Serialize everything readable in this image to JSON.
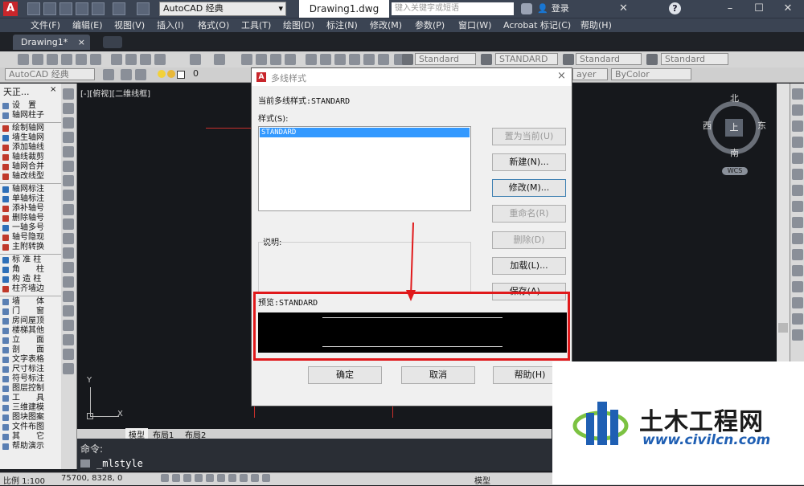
{
  "app": {
    "workspace": "AutoCAD 经典",
    "document_title": "Drawing1.dwg",
    "search_placeholder": "键入关键字或短语",
    "login": "登录"
  },
  "menu": [
    "文件(F)",
    "编辑(E)",
    "视图(V)",
    "插入(I)",
    "格式(O)",
    "工具(T)",
    "绘图(D)",
    "标注(N)",
    "修改(M)",
    "参数(P)",
    "窗口(W)",
    "Acrobat 标记(C)",
    "帮助(H)"
  ],
  "tabs": {
    "active": "Drawing1*"
  },
  "toolbar": {
    "text_style": "Standard",
    "dim_style": "STANDARD",
    "table_style": "Standard",
    "mleader_style": "Standard",
    "workspace2": "AutoCAD 经典",
    "layer_value": "0",
    "layer_right": "ayer",
    "color": "ByColor"
  },
  "palette": {
    "title": "天正...",
    "items": [
      "设　置",
      "轴网柱子",
      "绘制轴网",
      "墙生轴网",
      "添加轴线",
      "轴线裁剪",
      "轴网合并",
      "轴改线型",
      "轴网标注",
      "单轴标注",
      "添补轴号",
      "删除轴号",
      "一轴多号",
      "轴号隐现",
      "主附转换",
      "标 准 柱",
      "角　　柱",
      "构 造 柱",
      "柱齐墙边",
      "墙　　体",
      "门　　窗",
      "房间屋顶",
      "楼梯其他",
      "立　　面",
      "剖　　面",
      "文字表格",
      "尺寸标注",
      "符号标注",
      "图层控制",
      "工　　具",
      "三维建模",
      "图块图案",
      "文件布图",
      "其　　它",
      "帮助演示"
    ]
  },
  "viewport": {
    "label": "[-][俯视][二维线框]"
  },
  "viewcube": {
    "north": "北",
    "south": "南",
    "east": "东",
    "west": "西",
    "top": "上",
    "wcs": "WCS"
  },
  "dialog": {
    "title": "多线样式",
    "current_style_label": "当前多线样式:STANDARD",
    "styles_label": "样式(S):",
    "styles": [
      "STANDARD"
    ],
    "description_label": "说明:",
    "preview_label": "预览:STANDARD",
    "buttons": {
      "set_current": "置为当前(U)",
      "new": "新建(N)...",
      "modify": "修改(M)...",
      "rename": "重命名(R)",
      "delete": "删除(D)",
      "load": "加载(L)...",
      "save": "保存(A)...",
      "ok": "确定",
      "cancel": "取消",
      "help": "帮助(H)"
    },
    "highlight_color": "#e0191b"
  },
  "layout_tabs": [
    "模型",
    "布局1",
    "布局2"
  ],
  "command": {
    "history_label": "命令:",
    "current": "_mlstyle"
  },
  "status": {
    "scale": "比例 1:100",
    "coords": "75700, 8328, 0",
    "model": "模型"
  },
  "watermark": {
    "name": "土木工程网",
    "url": "www.civilcn.com"
  }
}
